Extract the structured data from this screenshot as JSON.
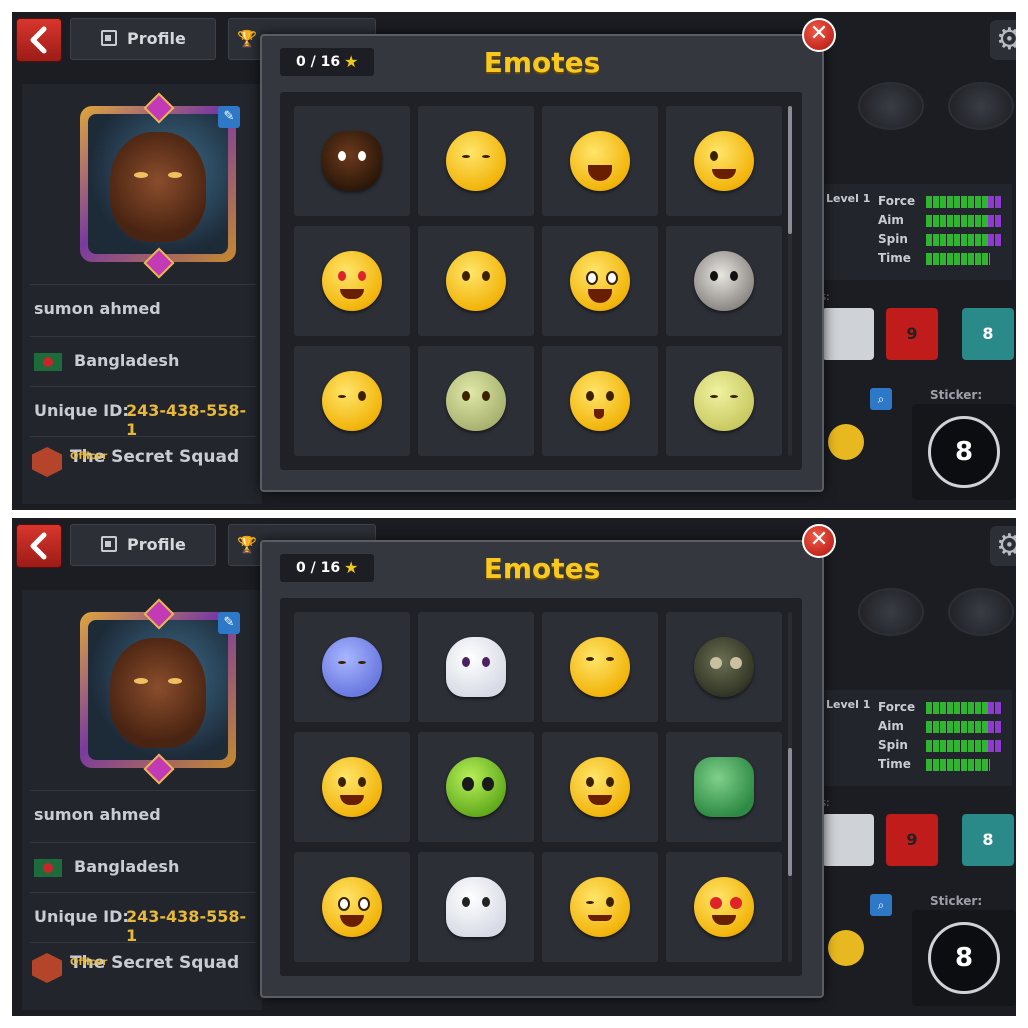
{
  "header": {
    "profile_tab_label": "Profile"
  },
  "profile": {
    "name": "sumon ahmed",
    "country": "Bangladesh",
    "unique_id_label": "Unique ID:",
    "unique_id_value": "243-438-558-1",
    "club_name": "The Secret Squad",
    "club_role": "Officer"
  },
  "stats": {
    "level_label": "Level 1",
    "items": [
      {
        "label": "Force"
      },
      {
        "label": "Aim"
      },
      {
        "label": "Spin"
      },
      {
        "label": "Time"
      }
    ],
    "truncated_label": "ts:",
    "sticker_label": "Sticker:",
    "ball_numbers": [
      "9",
      "8"
    ],
    "sticker_number": "8"
  },
  "modal": {
    "title": "Emotes",
    "counter": "0 / 16",
    "close_glyph": "✕"
  },
  "screens": [
    {
      "emotes": [
        {
          "name": "doberman"
        },
        {
          "name": "laurel-wreath"
        },
        {
          "name": "cowboy-hat"
        },
        {
          "name": "wink-100"
        },
        {
          "name": "heart-eyes-card"
        },
        {
          "name": "punk-microphone"
        },
        {
          "name": "drummer"
        },
        {
          "name": "plague-doctor"
        },
        {
          "name": "masquerade-kiss"
        },
        {
          "name": "theatre-masks"
        },
        {
          "name": "jester-cocktail"
        },
        {
          "name": "sick-8-ball"
        }
      ],
      "scroll_fraction": 0.0
    },
    {
      "emotes": [
        {
          "name": "wind-cloud"
        },
        {
          "name": "ghost-angry"
        },
        {
          "name": "smirk-thinking"
        },
        {
          "name": "gas-mask"
        },
        {
          "name": "winged-helmet-8-ball"
        },
        {
          "name": "alien"
        },
        {
          "name": "top-hat-magician"
        },
        {
          "name": "zombie-hand-8-ball"
        },
        {
          "name": "pirate-bandana"
        },
        {
          "name": "ghost-spooky"
        },
        {
          "name": "winking-face"
        },
        {
          "name": "heart-eyes"
        }
      ],
      "scroll_fraction": 0.62
    }
  ],
  "colors": {
    "title_yellow": "#f7c81e",
    "unique_id_gold": "#e8b83a",
    "close_red": "#c8261e",
    "stat_green": "#2fb52f",
    "stat_purple": "#8e3ad0"
  }
}
